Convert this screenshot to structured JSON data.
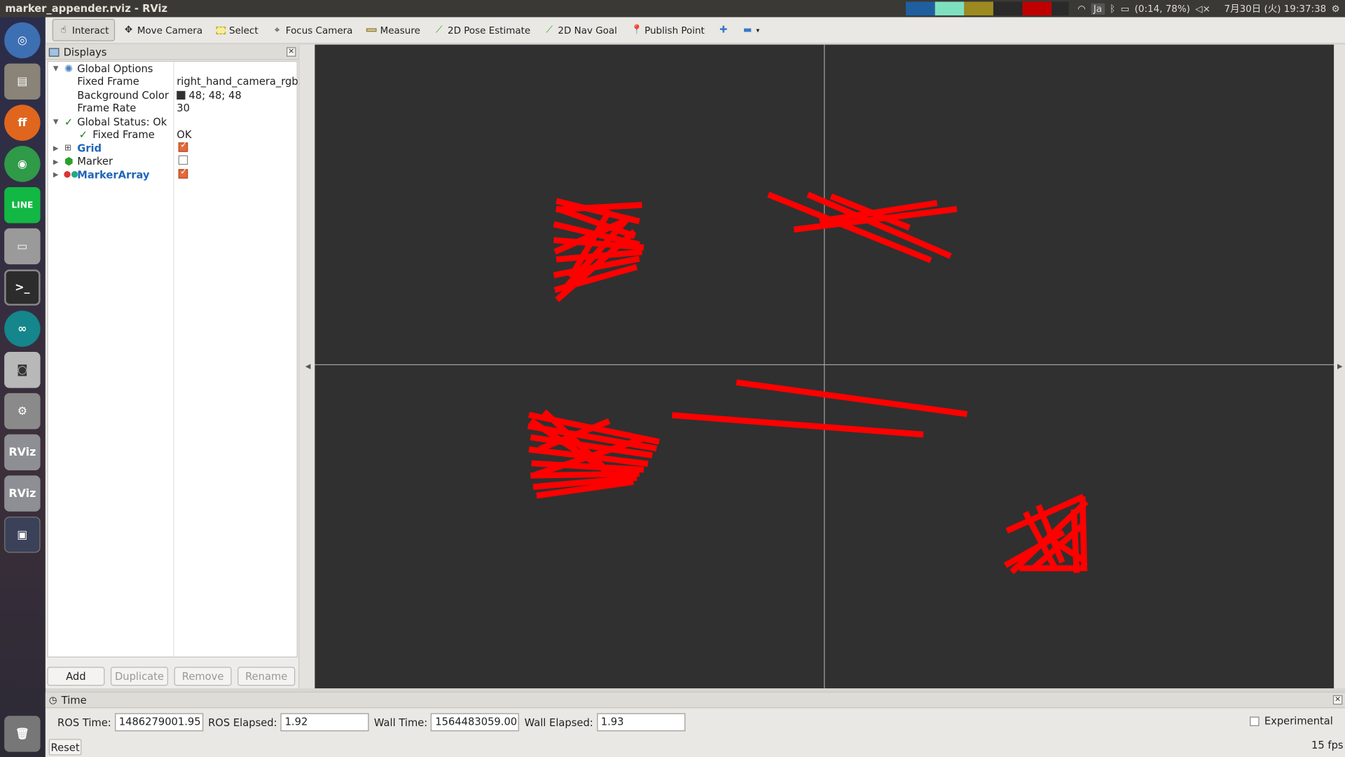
{
  "window": {
    "title": "marker_appender.rviz - RViz"
  },
  "tray": {
    "battery": "(0:14, 78%)",
    "ime": "Ja",
    "clock": "7月30日 (火) 19:37:38"
  },
  "launcher": {
    "items": [
      "ubuntu-dash",
      "files",
      "firefox",
      "chrome",
      "line",
      "disk",
      "terminal",
      "arduino",
      "camera",
      "system-settings",
      "rviz",
      "rviz",
      "workspaces",
      "trash"
    ]
  },
  "toolbar": {
    "tools": [
      {
        "label": "Interact",
        "icon": "hand-icon",
        "active": true
      },
      {
        "label": "Move Camera",
        "icon": "move-icon"
      },
      {
        "label": "Select",
        "icon": "select-box-icon"
      },
      {
        "label": "Focus Camera",
        "icon": "crosshair-icon"
      },
      {
        "label": "Measure",
        "icon": "ruler-icon"
      },
      {
        "label": "2D Pose Estimate",
        "icon": "green-arrow-icon"
      },
      {
        "label": "2D Nav Goal",
        "icon": "green-arrow-icon"
      },
      {
        "label": "Publish Point",
        "icon": "pin-icon"
      }
    ]
  },
  "displays": {
    "header": "Displays",
    "global_options": "Global Options",
    "fixed_frame_label": "Fixed Frame",
    "fixed_frame_value": "right_hand_camera_rgb...",
    "bg_color_label": "Background Color",
    "bg_color_value": "48; 48; 48",
    "frame_rate_label": "Frame Rate",
    "frame_rate_value": "30",
    "global_status": "Global Status: Ok",
    "status_fixed_frame": "Fixed Frame",
    "status_fixed_frame_value": "OK",
    "grid": "Grid",
    "marker": "Marker",
    "marker_array": "MarkerArray",
    "buttons": {
      "add": "Add",
      "duplicate": "Duplicate",
      "remove": "Remove",
      "rename": "Rename"
    }
  },
  "time": {
    "header": "Time",
    "ros_time_label": "ROS Time:",
    "ros_time": "1486279001.95",
    "ros_elapsed_label": "ROS Elapsed:",
    "ros_elapsed": "1.92",
    "wall_time_label": "Wall Time:",
    "wall_time": "1564483059.00",
    "wall_elapsed_label": "Wall Elapsed:",
    "wall_elapsed": "1.93",
    "experimental": "Experimental",
    "reset": "Reset",
    "fps": "15 fps"
  },
  "colors": {
    "viewport_bg": "#303030",
    "marker": "#ff0000",
    "grid": "#a0a0a0"
  }
}
